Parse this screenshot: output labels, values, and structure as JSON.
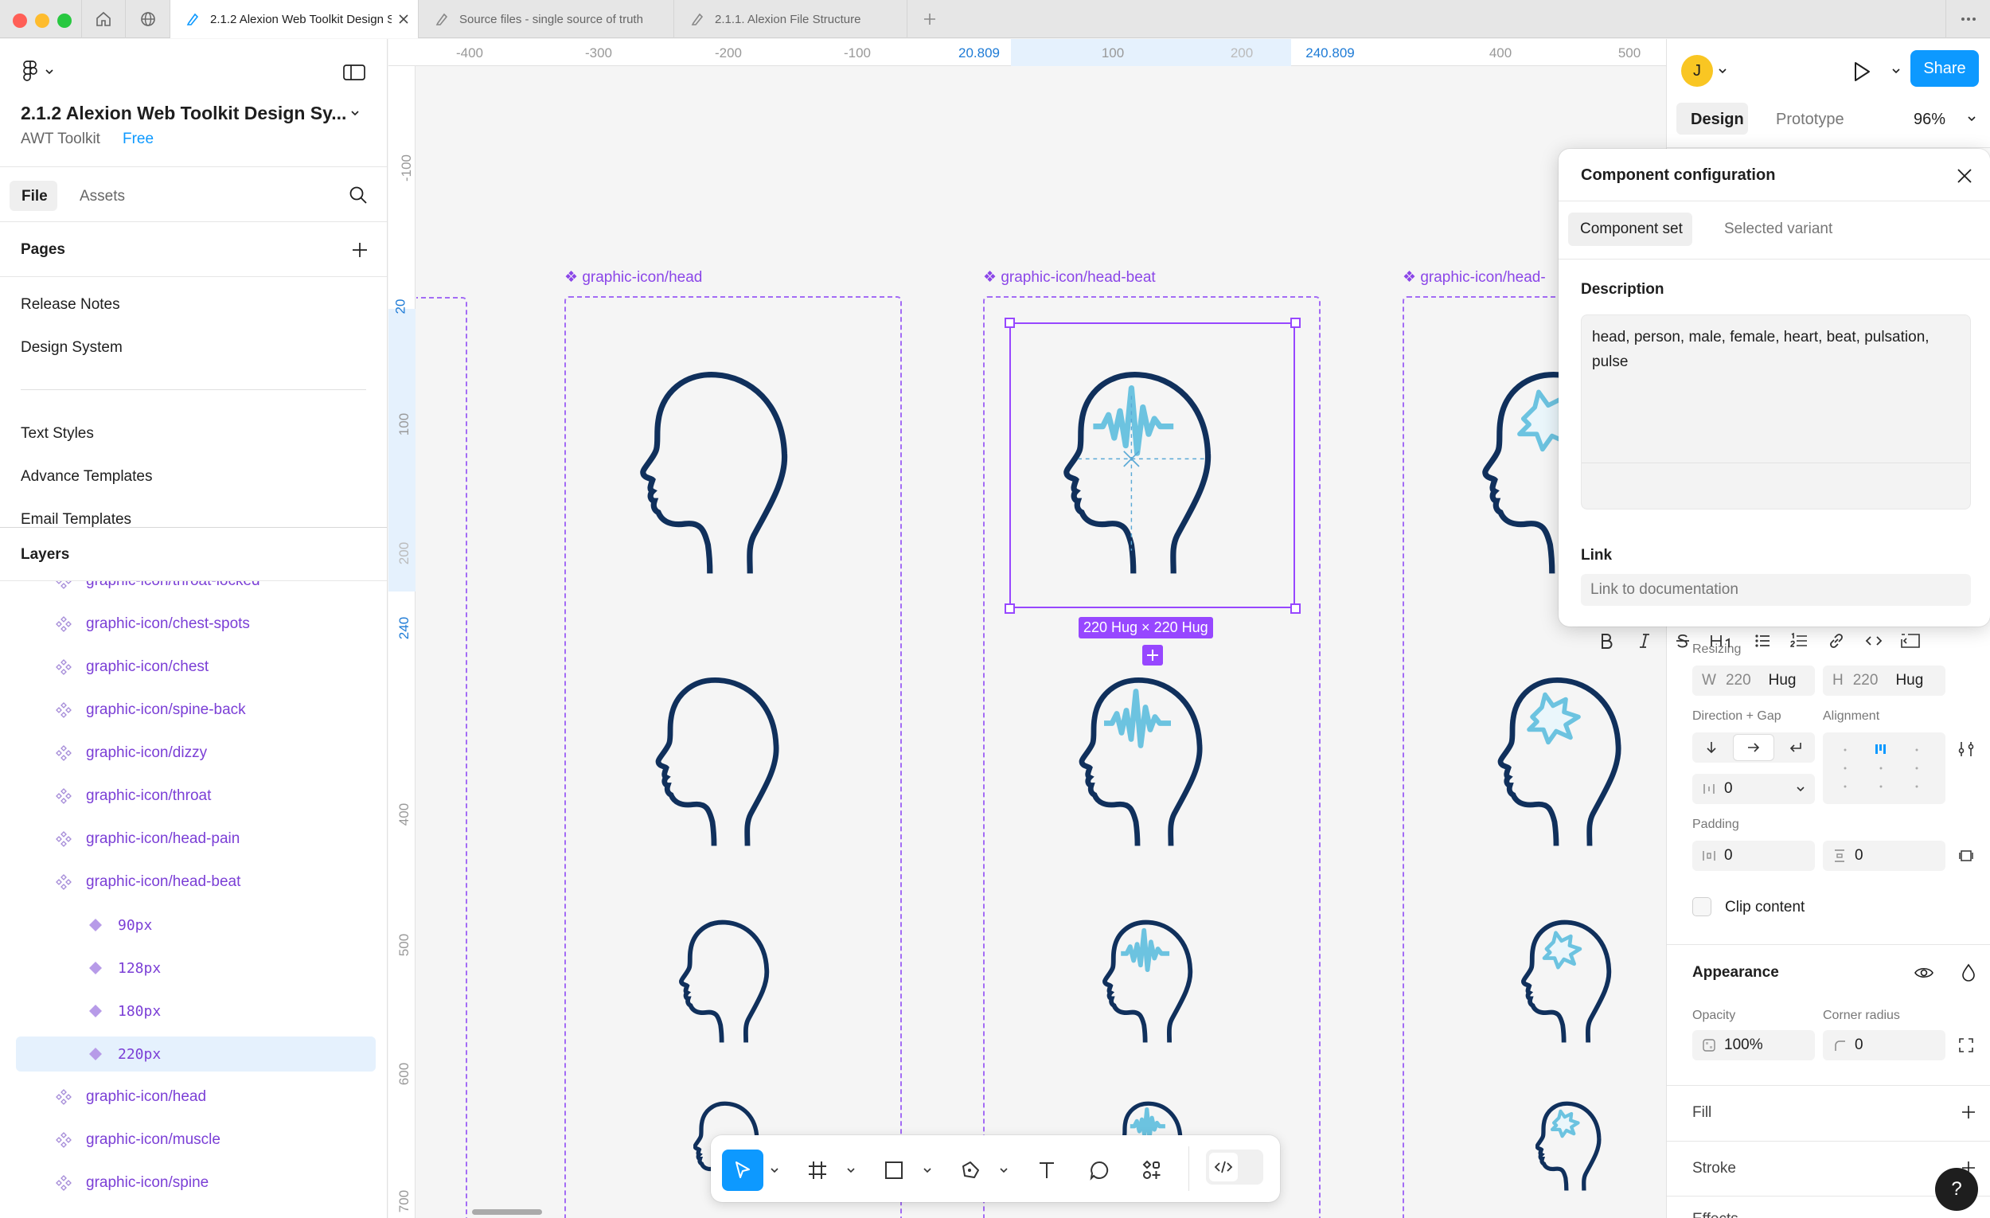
{
  "window": {
    "tabs": [
      {
        "label": "2.1.2 Alexion Web Toolkit Design System",
        "active": true
      },
      {
        "label": "Source files - single source of truth",
        "active": false
      },
      {
        "label": "2.1.1. Alexion File Structure",
        "active": false
      }
    ]
  },
  "file": {
    "name": "2.1.2 Alexion Web Toolkit Design Sy...",
    "team": "AWT Toolkit",
    "plan": "Free"
  },
  "left_panel": {
    "tabs": [
      "File",
      "Assets"
    ],
    "pages_title": "Pages",
    "pages": [
      "Release Notes",
      "Design System",
      "Text Styles",
      "Advance Templates",
      "Email Templates"
    ],
    "layers_title": "Layers",
    "layers": [
      {
        "label": "graphic-icon/throat-locked"
      },
      {
        "label": "graphic-icon/chest-spots"
      },
      {
        "label": "graphic-icon/chest"
      },
      {
        "label": "graphic-icon/spine-back"
      },
      {
        "label": "graphic-icon/dizzy"
      },
      {
        "label": "graphic-icon/throat"
      },
      {
        "label": "graphic-icon/head-pain"
      },
      {
        "label": "graphic-icon/head-beat"
      },
      {
        "label": "90px"
      },
      {
        "label": "128px"
      },
      {
        "label": "180px"
      },
      {
        "label": "220px"
      },
      {
        "label": "graphic-icon/head"
      },
      {
        "label": "graphic-icon/muscle"
      },
      {
        "label": "graphic-icon/spine"
      }
    ]
  },
  "rulers": {
    "top": [
      "-400",
      "-300",
      "-200",
      "-100",
      "20.809",
      "100",
      "200",
      "240.809",
      "400",
      "500"
    ],
    "left": [
      "-100",
      "20",
      "100",
      "200",
      "240",
      "400",
      "500",
      "600",
      "700"
    ]
  },
  "canvas": {
    "frames": [
      {
        "label": "graphic-icon/head"
      },
      {
        "label": "graphic-icon/head-beat"
      },
      {
        "label": "graphic-icon/head-"
      }
    ],
    "selection_badge": "220 Hug × 220 Hug"
  },
  "right_panel": {
    "user_initial": "J",
    "share_label": "Share",
    "tabs": [
      "Design",
      "Prototype"
    ],
    "zoom": "96%",
    "resizing": {
      "title": "Resizing",
      "w_label": "W",
      "w_value": "220",
      "w_mode": "Hug",
      "h_label": "H",
      "h_value": "220",
      "h_mode": "Hug"
    },
    "direction_title": "Direction + Gap",
    "alignment_title": "Alignment",
    "gap_value": "0",
    "padding": {
      "title": "Padding",
      "horizontal": "0",
      "vertical": "0"
    },
    "clip_content": "Clip content",
    "appearance": {
      "title": "Appearance",
      "opacity_label": "Opacity",
      "opacity": "100%",
      "radius_label": "Corner radius",
      "radius": "0"
    },
    "fill_title": "Fill",
    "stroke_title": "Stroke",
    "effects_title": "Effects"
  },
  "popup": {
    "title": "Component configuration",
    "tabs": [
      "Component set",
      "Selected variant"
    ],
    "description_label": "Description",
    "description": "head, person, male, female, heart, beat, pulsation, pulse",
    "link_label": "Link",
    "link_placeholder": "Link to documentation"
  },
  "help_label": "?",
  "colors": {
    "accent": "#0d99ff",
    "component_purple": "#8b46e8",
    "icon_navy": "#10305c",
    "icon_cyan": "#6cc3e0",
    "selection": "#9747ff"
  }
}
